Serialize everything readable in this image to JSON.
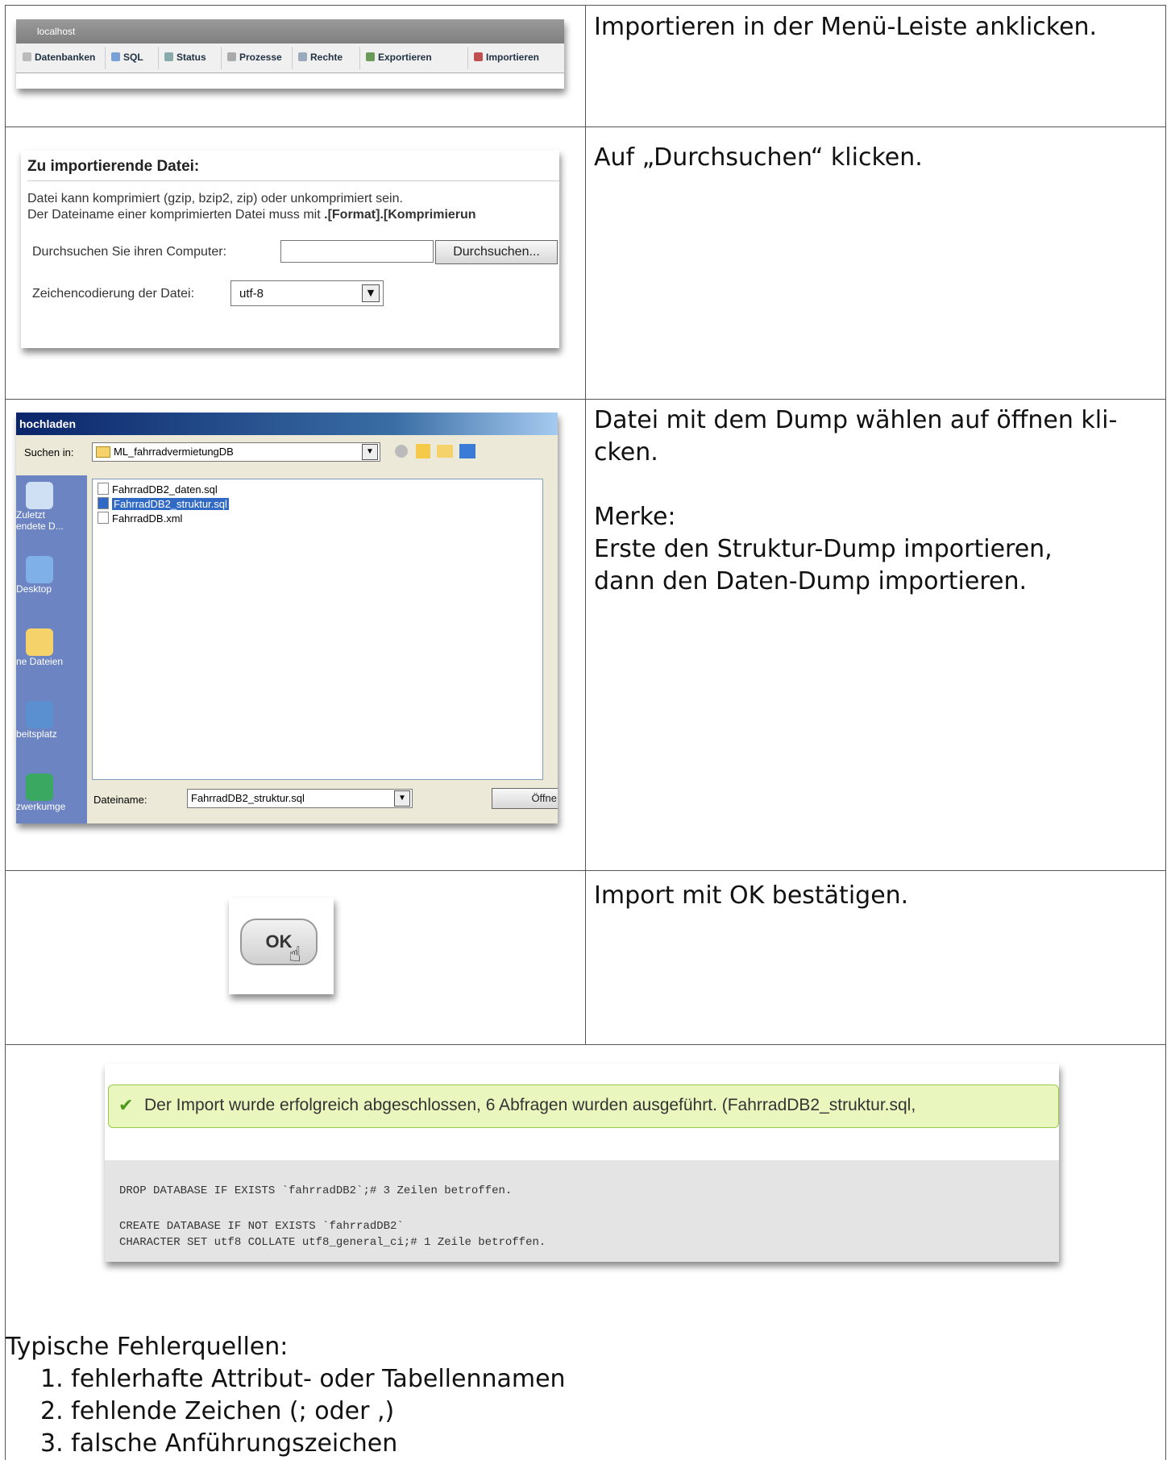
{
  "rows": [
    {
      "instruction": "Importieren in der Menü-Leiste anklicken."
    },
    {
      "instruction": "Auf „Durchsuchen“ klicken."
    },
    {
      "instruction_lines": [
        "Datei mit dem Dump wählen auf öffnen kli-",
        "cken."
      ],
      "note_title": "Merke:",
      "note_lines": [
        "Erste den Struktur-Dump importieren,",
        "dann den Daten-Dump importieren."
      ]
    },
    {
      "instruction": "Import mit OK bestätigen."
    }
  ],
  "menu_shot": {
    "host": "localhost",
    "tabs": [
      "Datenbanken",
      "SQL",
      "Status",
      "Prozesse",
      "Rechte",
      "Exportieren",
      "Importieren"
    ]
  },
  "form_shot": {
    "title": "Zu importierende Datei:",
    "line1": "Datei kann komprimiert (gzip, bzip2, zip) oder unkomprimiert sein.",
    "line2_prefix": "Der Dateiname einer komprimierten Datei muss mit ",
    "line2_bold": ".[Format].[Komprimierun",
    "browse_label": "Durchsuchen Sie ihren Computer:",
    "browse_button": "Durchsuchen...",
    "charset_label": "Zeichencodierung der Datei:",
    "charset_value": "utf-8"
  },
  "dialog_shot": {
    "title": "hochladen",
    "look_in_label": "Suchen in:",
    "look_in_value": "ML_fahrradvermietungDB",
    "files": [
      "FahrradDB2_daten.sql",
      "FahrradDB2_struktur.sql",
      "FahrradDB.xml"
    ],
    "selected_file": "FahrradDB2_struktur.sql",
    "places": [
      "Zuletzt",
      "endete D...",
      "Desktop",
      "ne Dateien",
      "beitsplatz",
      "zwerkumge"
    ],
    "filename_label": "Dateiname:",
    "filename_value": "FahrradDB2_struktur.sql",
    "open_button": "Öffne"
  },
  "ok_shot": {
    "label": "OK"
  },
  "result_shot": {
    "message": "Der Import wurde erfolgreich abgeschlossen, 6 Abfragen wurden ausgeführt. (FahrradDB2_struktur.sql,",
    "sql_lines": [
      "DROP DATABASE IF EXISTS `fahrradDB2`;# 3 Zeilen betroffen.",
      "CREATE DATABASE IF NOT EXISTS `fahrradDB2`",
      "CHARACTER SET utf8 COLLATE utf8_general_ci;# 1 Zeile betroffen."
    ]
  },
  "errors": {
    "heading": "Typische Fehlerquellen:",
    "items": [
      "1. fehlerhafte Attribut- oder Tabellennamen",
      "2. fehlende Zeichen (; oder ,)",
      "3. falsche Anführungszeichen"
    ]
  }
}
